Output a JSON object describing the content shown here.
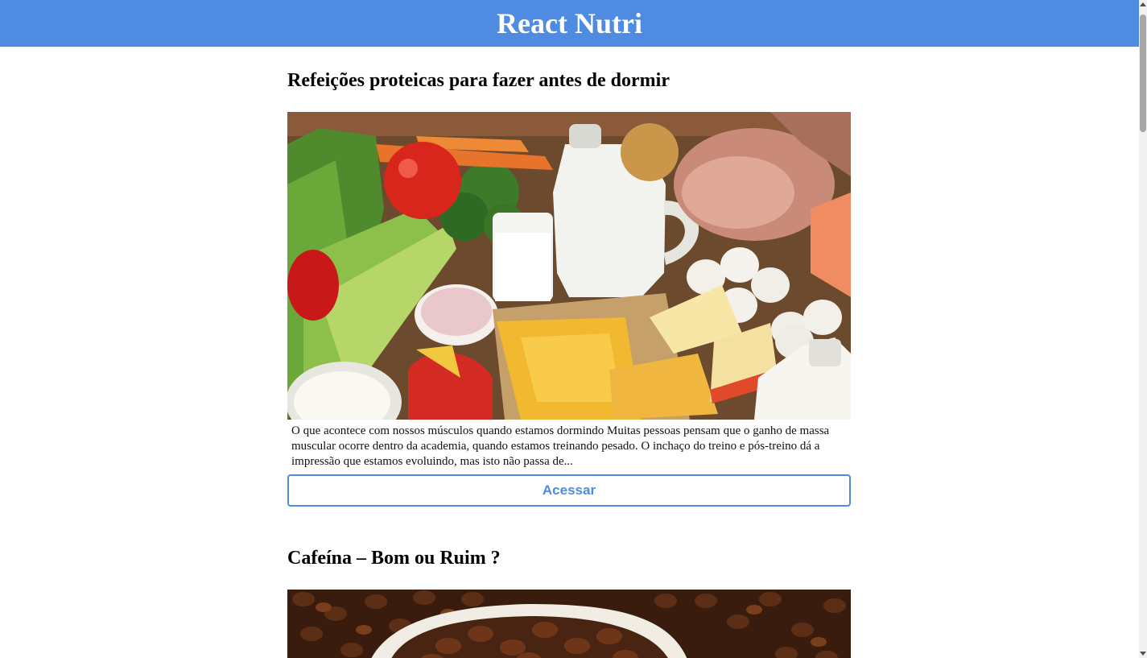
{
  "header": {
    "title": "React Nutri"
  },
  "posts": [
    {
      "title": "Refeições proteicas para fazer antes de dormir",
      "image_alt": "Alimentos ricos em proteína: leite, queijos, ovos, presunto, vegetais",
      "text": "O que acontece com nossos músculos quando estamos dormindo Muitas pessoas pensam que o ganho de massa muscular ocorre dentro da academia, quando estamos treinando pesado. O inchaço do treino e pós-treino dá a impressão que estamos evoluindo, mas isto não passa de...",
      "button_label": "Acessar"
    },
    {
      "title": "Cafeína – Bom ou Ruim ?",
      "image_alt": "Grãos de café em uma xícara"
    }
  ],
  "colors": {
    "brand": "#4f8be0",
    "text": "#000000",
    "background": "#ffffff"
  }
}
